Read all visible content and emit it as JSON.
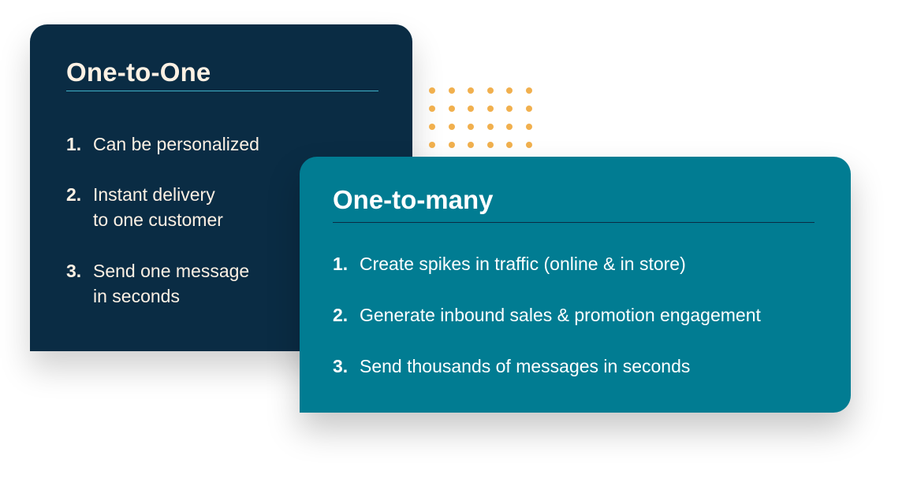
{
  "one_to_one": {
    "title": "One-to-One",
    "background_color": "#0a2c44",
    "text_color": "#fdf1e4",
    "rule_color": "#3fb1c9",
    "items": [
      {
        "number": "1.",
        "lines": [
          "Can be personalized"
        ]
      },
      {
        "number": "2.",
        "lines": [
          "Instant delivery",
          "to one customer"
        ]
      },
      {
        "number": "3.",
        "lines": [
          "Send one message",
          "in seconds"
        ]
      }
    ]
  },
  "one_to_many": {
    "title": "One-to-many",
    "background_color": "#017c92",
    "text_color": "#ffffff",
    "rule_color": "#0a2c44",
    "items": [
      {
        "number": "1.",
        "lines": [
          "Create spikes in traffic (online & in store)"
        ]
      },
      {
        "number": "2.",
        "lines": [
          "Generate inbound sales & promotion engagement"
        ]
      },
      {
        "number": "3.",
        "lines": [
          "Send thousands of messages in seconds"
        ]
      }
    ]
  },
  "decoration": {
    "dot_grid": {
      "columns": 6,
      "rows": 4,
      "color": "#f1b04e"
    }
  }
}
